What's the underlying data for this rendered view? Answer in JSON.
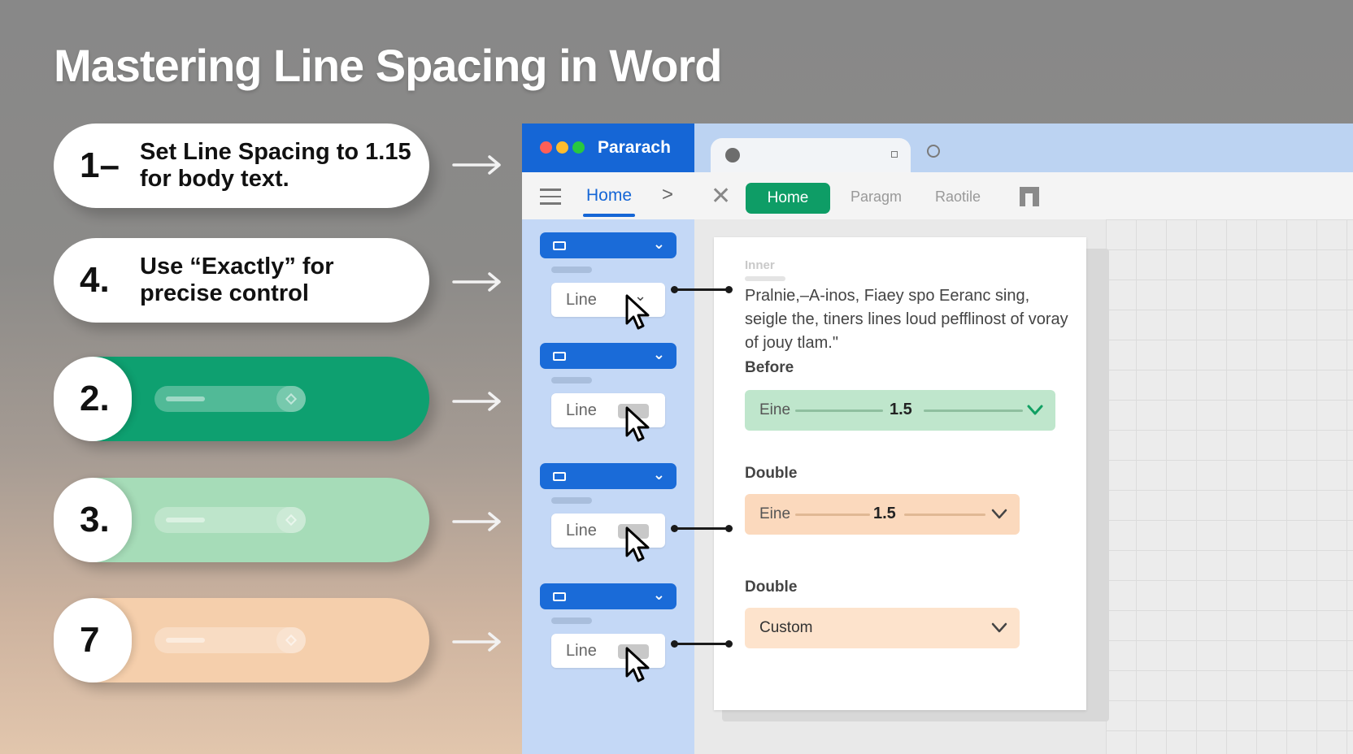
{
  "title": "Mastering Line Spacing in Word",
  "steps": [
    {
      "number": "1–",
      "text": "Set Line Spacing to 1.15 for body text.",
      "style": "white"
    },
    {
      "number": "4.",
      "text": "Use “Exactly” for precise control",
      "style": "white"
    },
    {
      "number": "2.",
      "text": "",
      "style": "green"
    },
    {
      "number": "3.",
      "text": "",
      "style": "mint"
    },
    {
      "number": "7",
      "text": "",
      "style": "peach"
    }
  ],
  "window": {
    "title": "Pararach",
    "traffic_lights": [
      "#ff5f57",
      "#febc2e",
      "#28c840"
    ]
  },
  "ribbon": {
    "home_tab": "Home",
    "home_button": "Home",
    "tab_2": "Paragm",
    "tab_3": "Raotile",
    "icons": [
      "menu-icon",
      "chevron-right-icon",
      "close-icon",
      "layout-icon"
    ]
  },
  "sidebar": {
    "groups": [
      {
        "line_label": "Line"
      },
      {
        "line_label": "Line"
      },
      {
        "line_label": "Line"
      },
      {
        "line_label": "Line"
      }
    ]
  },
  "document": {
    "faint_heading": "Inner",
    "paragraph": "Pralnie,–A-inos, Fiaey spo Eeranc sing, seigle the, tiners lines loud pefflinost of voray of jouy tlam.\"",
    "sections": [
      {
        "label": "Before",
        "control_label": "Eine",
        "value": "1.5"
      },
      {
        "label": "Double",
        "control_label": "Eine",
        "value": "1.5"
      },
      {
        "label": "Double",
        "control_label": "Custom",
        "value": ""
      }
    ]
  },
  "colors": {
    "brand_blue": "#1566d6",
    "green": "#0ea070",
    "mint": "#a6dcb8",
    "peach": "#f5cfac",
    "control_green": "#bfe6cc",
    "control_peach": "#fbd9bd",
    "control_peach_light": "#fde3cc"
  }
}
